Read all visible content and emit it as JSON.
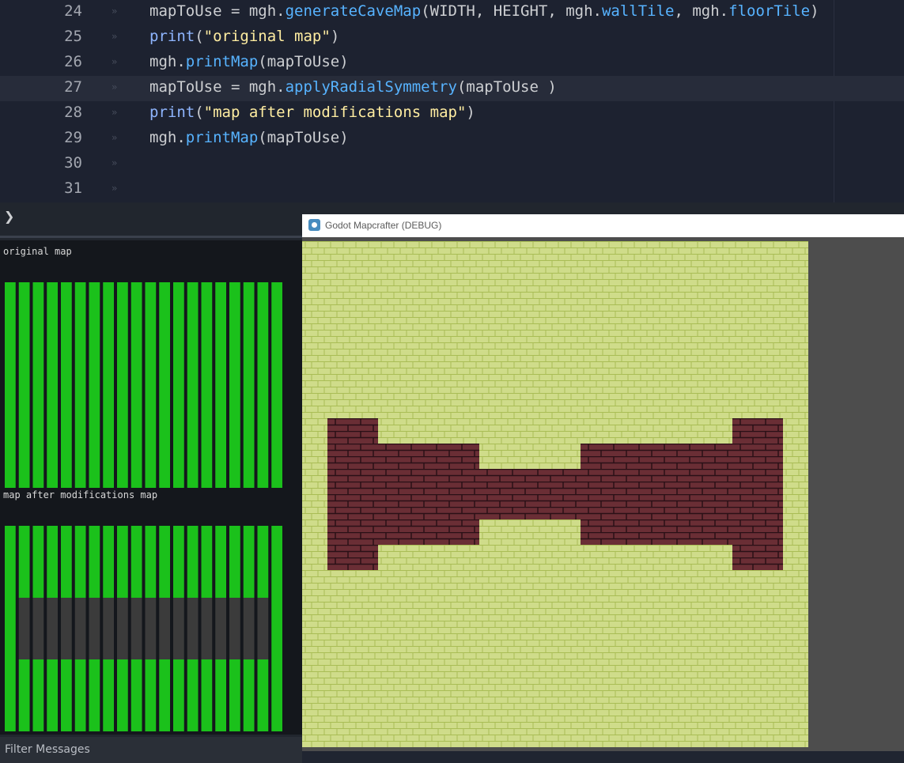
{
  "editor": {
    "current_line": 27,
    "lines": [
      {
        "number": "24",
        "tokens": [
          {
            "t": "mapToUse = mgh.",
            "c": "id"
          },
          {
            "t": "generateCaveMap",
            "c": "fn"
          },
          {
            "t": "(WIDTH, HEIGHT, mgh.",
            "c": "id"
          },
          {
            "t": "wallTile",
            "c": "fn"
          },
          {
            "t": ", mgh.",
            "c": "id"
          },
          {
            "t": "floorTile",
            "c": "fn"
          },
          {
            "t": ")",
            "c": "id"
          }
        ]
      },
      {
        "number": "25",
        "tokens": [
          {
            "t": "print",
            "c": "kw"
          },
          {
            "t": "(",
            "c": "id"
          },
          {
            "t": "\"original map\"",
            "c": "str"
          },
          {
            "t": ")",
            "c": "id"
          }
        ]
      },
      {
        "number": "26",
        "tokens": [
          {
            "t": "mgh.",
            "c": "id"
          },
          {
            "t": "printMap",
            "c": "fn"
          },
          {
            "t": "(mapToUse)",
            "c": "id"
          }
        ]
      },
      {
        "number": "27",
        "tokens": [
          {
            "t": "mapToUse = mgh.",
            "c": "id"
          },
          {
            "t": "applyRadialSymmetry",
            "c": "fn"
          },
          {
            "t": "(mapToUse )",
            "c": "id"
          }
        ]
      },
      {
        "number": "28",
        "tokens": [
          {
            "t": "print",
            "c": "kw"
          },
          {
            "t": "(",
            "c": "id"
          },
          {
            "t": "\"map after modifications map\"",
            "c": "str"
          },
          {
            "t": ")",
            "c": "id"
          }
        ]
      },
      {
        "number": "29",
        "tokens": [
          {
            "t": "mgh.",
            "c": "id"
          },
          {
            "t": "printMap",
            "c": "fn"
          },
          {
            "t": "(mapToUse)",
            "c": "id"
          }
        ]
      },
      {
        "number": "30",
        "tokens": []
      },
      {
        "number": "31",
        "tokens": []
      }
    ]
  },
  "bottom_panel": {
    "prompt_glyph": "❯",
    "output": {
      "first_label": "original map",
      "second_label": "map after modifications map",
      "original_map": [
        "00000000000000000000",
        "00000000000000000000",
        "00000000000000000000",
        "00000000000000000000",
        "00000000000000000000",
        "00000000000000000000",
        "00000000000000000000",
        "00000000000000000000",
        "00000000000000000000",
        "00000000000000000000",
        "00000000000000000000",
        "00000000000000000000",
        "00000000000000000000",
        "00000000000000000000",
        "00000000000000000000",
        "00000000000000000000",
        "00000000000000000000",
        "00000000000000000000",
        "00000000000000000000",
        "00000000000000000000"
      ],
      "modified_map": [
        "00000000000000000000",
        "00000000000000000000",
        "00000000000000000000",
        "00000000000000000000",
        "00000000000000000000",
        "00000000000000000000",
        "00000000000000000000",
        "01111111111111111110",
        "01111111111111111110",
        "01111111111111111110",
        "01111111111111111110",
        "01111111111111111110",
        "01111111111111111110",
        "00000000000000000000",
        "00000000000000000000",
        "00000000000000000000",
        "00000000000000000000",
        "00000000000000000000",
        "00000000000000000000",
        "00000000000000000000"
      ]
    },
    "filter_placeholder": "Filter Messages"
  },
  "game_window": {
    "title": "Godot Mapcrafter (DEBUG)",
    "map": [
      "00000000000000000000",
      "00000000000000000000",
      "00000000000000000000",
      "00000000000000000000",
      "00000000000000000000",
      "00000000000000000000",
      "00000000000000000000",
      "01100000000000000110",
      "01111110000111111110",
      "01111111111111111110",
      "01111111111111111110",
      "01111110000111111110",
      "01100000000000000110",
      "00000000000000000000",
      "00000000000000000000",
      "00000000000000000000",
      "00000000000000000000",
      "00000000000000000000",
      "00000000000000000000",
      "00000000000000000000"
    ]
  },
  "colors": {
    "floor_cell": "#1bc11b",
    "wall_cell": "#3b3b3b",
    "floor_tile": "#cfdc8a",
    "floor_tile_line": "#a9bd55",
    "wall_tile": "#6a2e35",
    "wall_tile_line": "#2a1016"
  }
}
